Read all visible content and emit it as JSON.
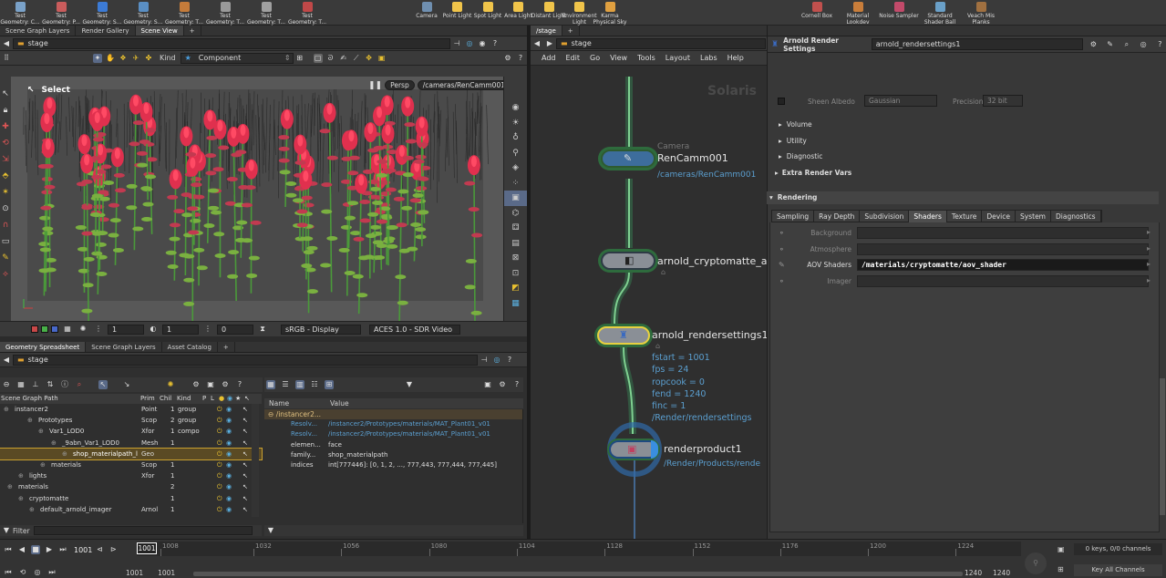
{
  "shelf": {
    "left": [
      {
        "label": "Test Geometry: C...",
        "color": "#7aa2c9"
      },
      {
        "label": "Test Geometry: P...",
        "color": "#c95c5c"
      },
      {
        "label": "Test Geometry: S...",
        "color": "#3c7bd6"
      },
      {
        "label": "Test Geometry: S...",
        "color": "#5a8fc4"
      },
      {
        "label": "Test Geometry: T...",
        "color": "#c47b3a"
      },
      {
        "label": "Test Geometry: T...",
        "color": "#9a9a9a"
      },
      {
        "label": "Test Geometry: T...",
        "color": "#a0a0a0"
      },
      {
        "label": "Test Geometry: T...",
        "color": "#c04848"
      }
    ],
    "lights": [
      {
        "label": "Camera",
        "color": "#6f8fb0"
      },
      {
        "label": "Point Light",
        "color": "#f0c44a"
      },
      {
        "label": "Spot Light",
        "color": "#f0c44a"
      },
      {
        "label": "Area Light",
        "color": "#f0c44a"
      },
      {
        "label": "Distant Light",
        "color": "#f0c44a"
      },
      {
        "label": "Environment Light",
        "color": "#f0c44a"
      },
      {
        "label": "Karma Physical Sky",
        "color": "#e0a040"
      }
    ],
    "right": [
      {
        "label": "Cornell Box",
        "color": "#c0504d"
      },
      {
        "label": "Material Lookdev",
        "color": "#c87d3a"
      },
      {
        "label": "Noise Sampler",
        "color": "#c24a6a"
      },
      {
        "label": "Standard Shader Ball",
        "color": "#6aa0c8"
      },
      {
        "label": "Veach Mis Planks",
        "color": "#a07040"
      }
    ]
  },
  "left_tabs": [
    "Scene Graph Layers",
    "Render Gallery",
    "Scene View"
  ],
  "viewer": {
    "path": "stage",
    "kind_label": "Kind",
    "kind_value": "Component",
    "select_label": "Select",
    "persp": "Persp",
    "camera": "/cameras/RenCamm001",
    "frame_a": "1",
    "frame_b": "1",
    "frame_c": "0",
    "display": "sRGB - Display",
    "view": "ACES 1.0 - SDR Video"
  },
  "lower_tabs": [
    "Geometry Spreadsheet",
    "Scene Graph Layers",
    "Asset Catalog"
  ],
  "spreadsheet": {
    "path": "stage",
    "filter_label": "Filter",
    "headers": {
      "path": "Scene Graph Path",
      "prim": "Prim",
      "chil": "Chil",
      "kind": "Kind",
      "p": "P",
      "l": "L"
    },
    "rows": [
      {
        "name": "instancer2",
        "prim": "Point",
        "chil": "1",
        "kind": "group",
        "indent": 4
      },
      {
        "name": "Prototypes",
        "prim": "Scop",
        "chil": "2",
        "kind": "group",
        "indent": 30
      },
      {
        "name": "Var1_LOD0",
        "prim": "Xfor",
        "chil": "1",
        "kind": "compo",
        "indent": 42
      },
      {
        "name": "_9abn_Var1_LOD0",
        "prim": "Mesh",
        "chil": "1",
        "kind": "",
        "indent": 56
      },
      {
        "name": "shop_materialpath_l",
        "prim": "Geo",
        "chil": "",
        "kind": "",
        "indent": 68
      },
      {
        "name": "materials",
        "prim": "Scop",
        "chil": "1",
        "kind": "",
        "indent": 44
      },
      {
        "name": "lights",
        "prim": "Xfor",
        "chil": "1",
        "kind": "",
        "indent": 20
      },
      {
        "name": "materials",
        "prim": "",
        "chil": "2",
        "kind": "",
        "indent": 8
      },
      {
        "name": "cryptomatte",
        "prim": "",
        "chil": "1",
        "kind": "",
        "indent": 20
      },
      {
        "name": "default_arnold_imager",
        "prim": "Arnol",
        "chil": "1",
        "kind": "",
        "indent": 32
      }
    ]
  },
  "details": {
    "headers": {
      "name": "Name",
      "value": "Value"
    },
    "group": "/instancer2...",
    "rows": [
      {
        "name": "Resolv...",
        "value": "/instancer2/Prototypes/materials/MAT_Plant01_v01",
        "blue": true
      },
      {
        "name": "Resolv...",
        "value": "/instancer2/Prototypes/materials/MAT_Plant01_v01",
        "blue": true
      },
      {
        "name": "elemen...",
        "value": "face",
        "blue": false
      },
      {
        "name": "family...",
        "value": "shop_materialpath",
        "blue": false
      },
      {
        "name": "indices",
        "value": "int[777446]: [0, 1, 2, ..., 777,443, 777,444, 777,445]",
        "blue": false
      }
    ]
  },
  "net": {
    "tab": "/stage",
    "path": "stage",
    "menu": [
      "Add",
      "Edit",
      "Go",
      "View",
      "Tools",
      "Layout",
      "Labs",
      "Help"
    ],
    "watermark": "Solaris",
    "nodes": {
      "cam_type": "Camera",
      "cam": "RenCamm001",
      "cam_path": "/cameras/RenCamm001",
      "crypto": "arnold_cryptomatte_ac",
      "rs": "arnold_rendersettings1",
      "rp": "renderproduct1",
      "rp_path": "/Render/Products/rende"
    },
    "info": [
      "fstart = 1001",
      "fps = 24",
      "ropcook = 0",
      "fend = 1240",
      "finc = 1",
      "/Render/rendersettings"
    ]
  },
  "params": {
    "type": "Arnold Render Settings",
    "name": "arnold_rendersettings1",
    "sheen_label": "Sheen Albedo",
    "sheen_value": "Gaussian",
    "precision_label": "Precision",
    "precision_value": "32 bit",
    "folders": [
      "Volume",
      "Utility",
      "Diagnostic"
    ],
    "extra": "Extra Render Vars",
    "section": "Rendering",
    "tabs": [
      "Sampling",
      "Ray Depth",
      "Subdivision",
      "Shaders",
      "Texture",
      "Device",
      "System",
      "Diagnostics"
    ],
    "active_tab": "Shaders",
    "rows": [
      {
        "label": "Background",
        "value": ""
      },
      {
        "label": "Atmosphere",
        "value": ""
      },
      {
        "label": "AOV Shaders",
        "value": "/materials/cryptomatte/aov_shader"
      },
      {
        "label": "Imager",
        "value": ""
      }
    ]
  },
  "timeline": {
    "frame": "1001",
    "cursor": "1001",
    "ticks": [
      "1008",
      "1032",
      "1056",
      "1080",
      "1104",
      "1128",
      "1152",
      "1176",
      "1200",
      "1224"
    ],
    "start": "1001",
    "start2": "1001",
    "end": "1240",
    "end2": "1240",
    "keys": "0 keys, 0/0 channels",
    "key_all": "Key All Channels"
  }
}
